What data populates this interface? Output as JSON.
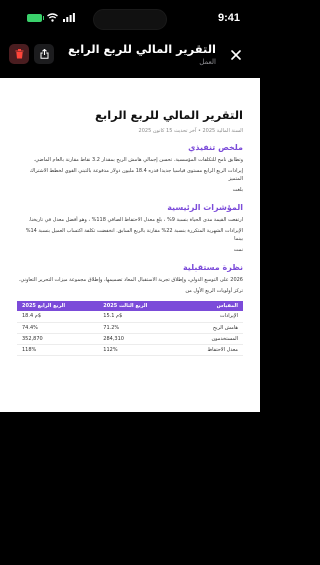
{
  "status": {
    "time": "9:41"
  },
  "header": {
    "title": "التقرير المالي للربع الرابع",
    "subtitle": "العمل"
  },
  "doc": {
    "title": "التقرير المالي للربع الرابع",
    "meta": "السنة المالية 2025 • آخر تحديث 15 كانون 2025",
    "sections": [
      {
        "heading": "ملخص تنفيذي",
        "lines": [
          "وتطابق نامج للتكلفات المؤسسية. تحسن إجمالي هامش الربح بمقدار 3.2 نقاط مقارنة بالعام الماضي.",
          "إيرادات الربع الرابع مستوى قياسيا جديدا قدره 18.4 مليون دولار مدفوعة بالتبني القوي لخطط الاشتراك المتميز",
          "بلغت"
        ]
      },
      {
        "heading": "المؤشرات الرئيسية",
        "lines": [
          "ارتفعت القيمة مدى الحياة بنسبة 9% ، بلغ معدل الاحتفاظ الصافي 118% ، وهو أفضل معدل في تاريخنا.",
          "الإيرادات الشهرية المتكررة بنسبة 22% مقارنة بالربع السابق. انخفضت تكلفة اكتساب العميل بنسبة 14% بينما",
          "نمت"
        ]
      },
      {
        "heading": "نظرة مستقبلية",
        "lines": [
          "2026 على التوسع الدولي، وإطلاق تجربة الاستقبال المعاد تصميمها، وإطلاق مجموعة ميزات التحرير التعاوني.",
          "تركز أولويات الربع الأول من"
        ]
      }
    ],
    "table": {
      "headers": [
        "المقياس",
        "الربع الثالث 2025",
        "الربع الرابع 2025"
      ],
      "rows": [
        [
          "الإيرادات",
          "15.1 م$",
          "18.4 م$"
        ],
        [
          "هامش الربح",
          "71.2%",
          "74.4%"
        ],
        [
          "المستخدمون",
          "284,310",
          "352,870"
        ],
        [
          "معدل الاحتفاظ",
          "112%",
          "118%"
        ]
      ]
    }
  },
  "colors": {
    "accent": "#7b4bd9",
    "battery": "#3ad16b",
    "delete_bg": "#4a1d20",
    "delete_icon": "#ff453a"
  },
  "icons": [
    "battery-icon",
    "wifi-icon",
    "signal-icon",
    "trash-icon",
    "share-icon",
    "close-icon"
  ]
}
